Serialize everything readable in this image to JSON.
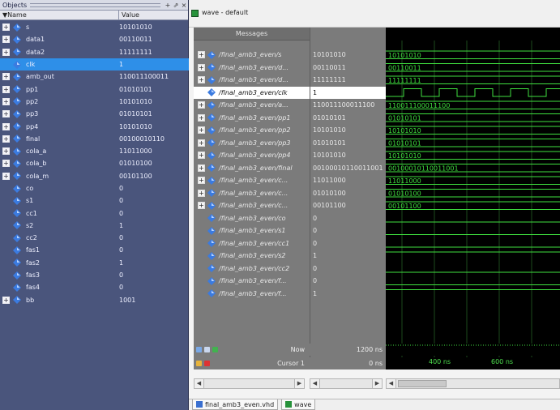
{
  "objects_panel": {
    "title": "Objects",
    "col_name": "Name",
    "col_value": "Value",
    "rows": [
      {
        "name": "s",
        "value": "10101010",
        "exp": true,
        "sel": false
      },
      {
        "name": "data1",
        "value": "00110011",
        "exp": true,
        "sel": false
      },
      {
        "name": "data2",
        "value": "11111111",
        "exp": true,
        "sel": false
      },
      {
        "name": "clk",
        "value": "1",
        "exp": false,
        "sel": true
      },
      {
        "name": "amb_out",
        "value": "110011100011",
        "exp": true,
        "sel": false
      },
      {
        "name": "pp1",
        "value": "01010101",
        "exp": true,
        "sel": false
      },
      {
        "name": "pp2",
        "value": "10101010",
        "exp": true,
        "sel": false
      },
      {
        "name": "pp3",
        "value": "01010101",
        "exp": true,
        "sel": false
      },
      {
        "name": "pp4",
        "value": "10101010",
        "exp": true,
        "sel": false
      },
      {
        "name": "final",
        "value": "00100010110",
        "exp": true,
        "sel": false
      },
      {
        "name": "cola_a",
        "value": "11011000",
        "exp": true,
        "sel": false
      },
      {
        "name": "cola_b",
        "value": "01010100",
        "exp": true,
        "sel": false
      },
      {
        "name": "cola_m",
        "value": "00101100",
        "exp": true,
        "sel": false
      },
      {
        "name": "co",
        "value": "0",
        "exp": false,
        "sel": false
      },
      {
        "name": "s1",
        "value": "0",
        "exp": false,
        "sel": false
      },
      {
        "name": "cc1",
        "value": "0",
        "exp": false,
        "sel": false
      },
      {
        "name": "s2",
        "value": "1",
        "exp": false,
        "sel": false
      },
      {
        "name": "cc2",
        "value": "0",
        "exp": false,
        "sel": false
      },
      {
        "name": "fas1",
        "value": "0",
        "exp": false,
        "sel": false
      },
      {
        "name": "fas2",
        "value": "1",
        "exp": false,
        "sel": false
      },
      {
        "name": "fas3",
        "value": "0",
        "exp": false,
        "sel": false
      },
      {
        "name": "fas4",
        "value": "0",
        "exp": false,
        "sel": false
      },
      {
        "name": "bb",
        "value": "1001",
        "exp": true,
        "sel": false
      }
    ]
  },
  "wave_window": {
    "title": "wave - default",
    "messages_header": "Messages",
    "rows": [
      {
        "name": "/final_amb3_even/s",
        "value": "10101010",
        "wave_label": "10101010",
        "kind": "bus",
        "exp": true,
        "sel": false
      },
      {
        "name": "/final_amb3_even/d...",
        "value": "00110011",
        "wave_label": "00110011",
        "kind": "bus",
        "exp": true,
        "sel": false
      },
      {
        "name": "/final_amb3_even/d...",
        "value": "11111111",
        "wave_label": "11111111",
        "kind": "bus",
        "exp": true,
        "sel": false
      },
      {
        "name": "/final_amb3_even/clk",
        "value": "1",
        "wave_label": "",
        "kind": "clock",
        "exp": false,
        "sel": true
      },
      {
        "name": "/final_amb3_even/a...",
        "value": "110011100011100",
        "wave_label": "110011100011100",
        "kind": "bus",
        "exp": true,
        "sel": false
      },
      {
        "name": "/final_amb3_even/pp1",
        "value": "01010101",
        "wave_label": "01010101",
        "kind": "bus",
        "exp": true,
        "sel": false
      },
      {
        "name": "/final_amb3_even/pp2",
        "value": "10101010",
        "wave_label": "10101010",
        "kind": "bus",
        "exp": true,
        "sel": false
      },
      {
        "name": "/final_amb3_even/pp3",
        "value": "01010101",
        "wave_label": "01010101",
        "kind": "bus",
        "exp": true,
        "sel": false
      },
      {
        "name": "/final_amb3_even/pp4",
        "value": "10101010",
        "wave_label": "10101010",
        "kind": "bus",
        "exp": true,
        "sel": false
      },
      {
        "name": "/final_amb3_even/final",
        "value": "00100010110011001",
        "wave_label": "00100010110011001",
        "kind": "bus",
        "exp": true,
        "sel": false
      },
      {
        "name": "/final_amb3_even/c...",
        "value": "11011000",
        "wave_label": "11011000",
        "kind": "bus",
        "exp": true,
        "sel": false
      },
      {
        "name": "/final_amb3_even/c...",
        "value": "01010100",
        "wave_label": "01010100",
        "kind": "bus",
        "exp": true,
        "sel": false
      },
      {
        "name": "/final_amb3_even/c...",
        "value": "00101100",
        "wave_label": "00101100",
        "kind": "bus",
        "exp": true,
        "sel": false
      },
      {
        "name": "/final_amb3_even/co",
        "value": "0",
        "wave_label": "",
        "kind": "low",
        "exp": false,
        "sel": false
      },
      {
        "name": "/final_amb3_even/s1",
        "value": "0",
        "wave_label": "",
        "kind": "low",
        "exp": false,
        "sel": false
      },
      {
        "name": "/final_amb3_even/cc1",
        "value": "0",
        "wave_label": "",
        "kind": "low",
        "exp": false,
        "sel": false
      },
      {
        "name": "/final_amb3_even/s2",
        "value": "1",
        "wave_label": "",
        "kind": "high",
        "exp": false,
        "sel": false
      },
      {
        "name": "/final_amb3_even/cc2",
        "value": "0",
        "wave_label": "",
        "kind": "low",
        "exp": false,
        "sel": false
      },
      {
        "name": "/final_amb3_even/f...",
        "value": "0",
        "wave_label": "",
        "kind": "low",
        "exp": false,
        "sel": false
      },
      {
        "name": "/final_amb3_even/f...",
        "value": "1",
        "wave_label": "",
        "kind": "high",
        "exp": false,
        "sel": false
      }
    ],
    "now_label": "Now",
    "now_value": "1200 ns",
    "cursor_label": "Cursor 1",
    "cursor_value": "0 ns",
    "time_ticks": [
      "400 ns",
      "600 ns"
    ]
  },
  "tabs": [
    {
      "label": "final_amb3_even.vhd"
    },
    {
      "label": "wave"
    }
  ],
  "colors": {
    "objects_bg": "#4a557c",
    "selection": "#2e8fe8",
    "wave_green": "#3fe03f",
    "signal_icon": "#3b7be0"
  }
}
